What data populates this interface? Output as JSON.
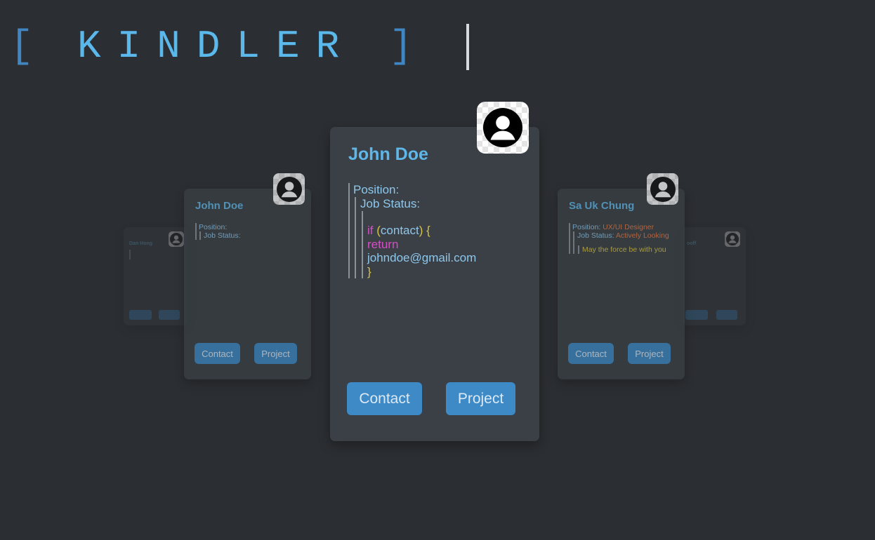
{
  "app": {
    "logo_left_bracket": "[",
    "logo_word": "KINDLER",
    "logo_right_bracket": "]"
  },
  "colors": {
    "background": "#2b2e32",
    "card": "#3a4045",
    "accent": "#5fb7e9",
    "button": "#3d8ac7",
    "keyword": "#d44fc6",
    "paren": "#d8c34a",
    "value": "#e07b4a"
  },
  "cards": {
    "main": {
      "name": "John Doe",
      "avatar_icon": "user-avatar-icon",
      "position_label": "Position:",
      "job_status_label": "Job Status:",
      "code_if": "if",
      "code_paren_open": "(",
      "code_var": "contact",
      "code_paren_close": ")",
      "code_brace_open": "{",
      "code_return": "return",
      "code_email": "johndoe@gmail.com",
      "code_brace_close": "}",
      "contact_label": "Contact",
      "project_label": "Project"
    },
    "left": {
      "name": "John Doe",
      "position_label": "Position:",
      "job_status_label": "Job Status:",
      "contact_label": "Contact",
      "project_label": "Project"
    },
    "right": {
      "name": "Sa Uk Chung",
      "position_label": "Position:",
      "position_value": "UX/UI Designer",
      "job_status_label": "Job Status:",
      "job_status_value": "Actively Looking",
      "quote": "May the force be with you",
      "contact_label": "Contact",
      "project_label": "Project"
    },
    "far_left": {
      "name": "Dan Hong"
    },
    "far_right": {
      "name": "ooff"
    }
  }
}
